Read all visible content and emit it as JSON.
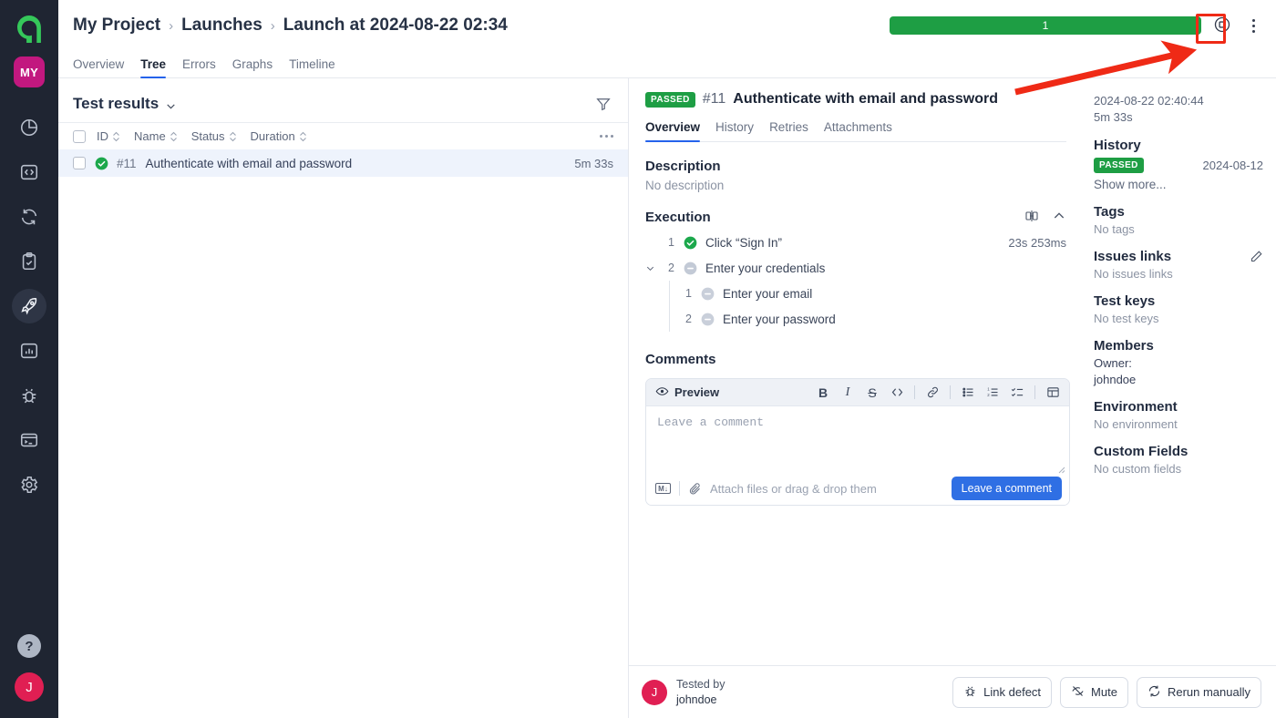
{
  "rail": {
    "logo": "a",
    "project_badge": "MY",
    "items": [
      {
        "name": "dashboards",
        "icon": "pie-chart-icon"
      },
      {
        "name": "code",
        "icon": "code-brackets-icon"
      },
      {
        "name": "sync",
        "icon": "sync-icon"
      },
      {
        "name": "test-plan",
        "icon": "clipboard-check-icon"
      },
      {
        "name": "launches",
        "icon": "rocket-icon",
        "active": true
      },
      {
        "name": "analytics",
        "icon": "bar-chart-icon"
      },
      {
        "name": "defects",
        "icon": "bug-icon"
      },
      {
        "name": "console",
        "icon": "terminal-icon"
      },
      {
        "name": "settings",
        "icon": "gear-icon"
      }
    ],
    "help": "?",
    "avatar": "J"
  },
  "breadcrumb": {
    "project": "My Project",
    "section": "Launches",
    "current": "Launch at 2024-08-22 02:34",
    "separator": "›"
  },
  "topbar": {
    "progress_label": "1",
    "progress_color": "#1e9e44",
    "stop_icon": "circle-square-icon",
    "menu_icon": "kebab-menu-icon"
  },
  "tabs": [
    {
      "label": "Overview",
      "active": false
    },
    {
      "label": "Tree",
      "active": true
    },
    {
      "label": "Errors",
      "active": false
    },
    {
      "label": "Graphs",
      "active": false
    },
    {
      "label": "Timeline",
      "active": false
    }
  ],
  "results": {
    "title": "Test results",
    "filter_icon": "filter-icon",
    "columns": [
      "ID",
      "Name",
      "Status",
      "Duration"
    ],
    "rows": [
      {
        "id": "#11",
        "name": "Authenticate with email and password",
        "status": "passed",
        "duration": "5m 33s"
      }
    ]
  },
  "detail": {
    "status_badge": "PASSED",
    "test_id": "#11",
    "test_name": "Authenticate with email and password",
    "subtabs": [
      {
        "label": "Overview",
        "active": true
      },
      {
        "label": "History",
        "active": false
      },
      {
        "label": "Retries",
        "active": false
      },
      {
        "label": "Attachments",
        "active": false
      }
    ],
    "description": {
      "title": "Description",
      "value": "No description"
    },
    "execution": {
      "title": "Execution",
      "compare_icon": "split-compare-icon",
      "collapse_icon": "chevron-up-icon",
      "steps": [
        {
          "num": "1",
          "status": "passed",
          "label": "Click “Sign In”",
          "duration": "23s 253ms",
          "expandable": false
        },
        {
          "num": "2",
          "status": "skipped",
          "label": "Enter your credentials",
          "duration": "",
          "expandable": true,
          "substeps": [
            {
              "num": "1",
              "status": "skipped",
              "label": "Enter your email"
            },
            {
              "num": "2",
              "status": "skipped",
              "label": "Enter your password"
            }
          ]
        }
      ]
    },
    "comments": {
      "title": "Comments",
      "preview_label": "Preview",
      "toolbar": [
        "bold",
        "italic",
        "strikethrough",
        "code",
        "link",
        "bullet-list",
        "numbered-list",
        "check-list",
        "table"
      ],
      "bold_label": "B",
      "italic_label": "I",
      "strike_label": "S",
      "placeholder": "Leave a comment",
      "markdown_label": "M",
      "attach_text": "Attach files or drag & drop them",
      "submit_label": "Leave a comment"
    }
  },
  "side": {
    "timestamp": "2024-08-22 02:40:44",
    "duration": "5m 33s",
    "history": {
      "title": "History",
      "entries": [
        {
          "status": "PASSED",
          "date": "2024-08-12"
        }
      ],
      "show_more": "Show more..."
    },
    "tags": {
      "title": "Tags",
      "value": "No tags"
    },
    "issues": {
      "title": "Issues links",
      "value": "No issues links",
      "edit_icon": "pencil-icon"
    },
    "test_keys": {
      "title": "Test keys",
      "value": "No test keys"
    },
    "members": {
      "title": "Members",
      "owner_label": "Owner:",
      "owner": "johndoe"
    },
    "environment": {
      "title": "Environment",
      "value": "No environment"
    },
    "custom_fields": {
      "title": "Custom Fields",
      "value": "No custom fields"
    }
  },
  "footer": {
    "avatar": "J",
    "tested_by_label": "Tested by",
    "tested_by_user": "johndoe",
    "buttons": [
      {
        "label": "Link defect",
        "icon": "bug-icon"
      },
      {
        "label": "Mute",
        "icon": "eye-off-icon"
      },
      {
        "label": "Rerun manually",
        "icon": "rerun-icon"
      }
    ]
  },
  "annotation": {
    "color": "#ef2a16",
    "target": "stop-recording-button"
  }
}
